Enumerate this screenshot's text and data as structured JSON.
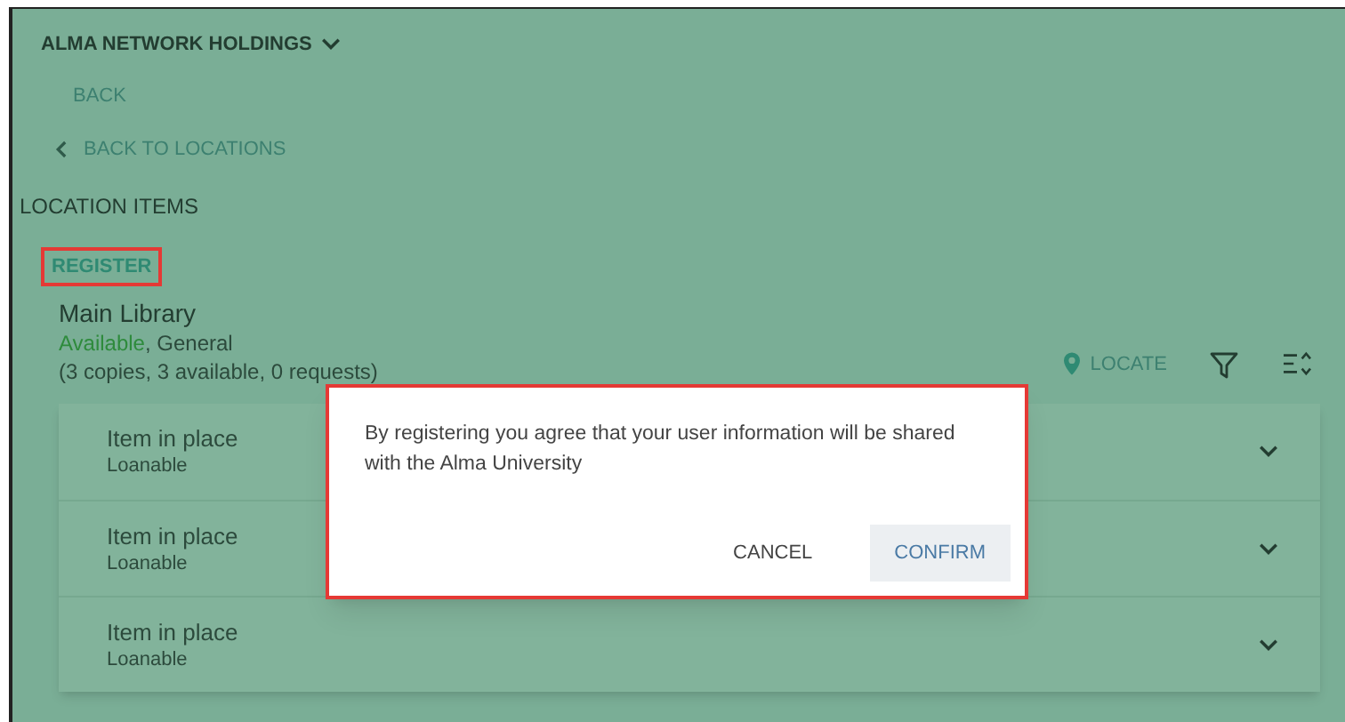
{
  "header": {
    "institution": "ALMA NETWORK HOLDINGS",
    "back": "BACK",
    "back_to_locations": "BACK TO LOCATIONS",
    "section_title": "LOCATION ITEMS"
  },
  "register": {
    "label": "REGISTER",
    "highlighted": true
  },
  "location": {
    "name": "Main Library",
    "availability": "Available",
    "collection": ", General",
    "summary": "(3 copies, 3 available, 0 requests)"
  },
  "toolbar": {
    "locate": "LOCATE"
  },
  "items": [
    {
      "status": "Item in place",
      "policy": "Loanable",
      "expanded": false
    },
    {
      "status": "Item in place",
      "policy": "Loanable",
      "expanded": false
    },
    {
      "status": "Item in place",
      "policy": "Loanable",
      "expanded": false
    }
  ],
  "dialog": {
    "message": "By registering you agree that your user information will be shared with the Alma University",
    "buttons": [
      {
        "label": "CANCEL",
        "kind": "text"
      },
      {
        "label": "CONFIRM",
        "kind": "filled"
      }
    ]
  }
}
